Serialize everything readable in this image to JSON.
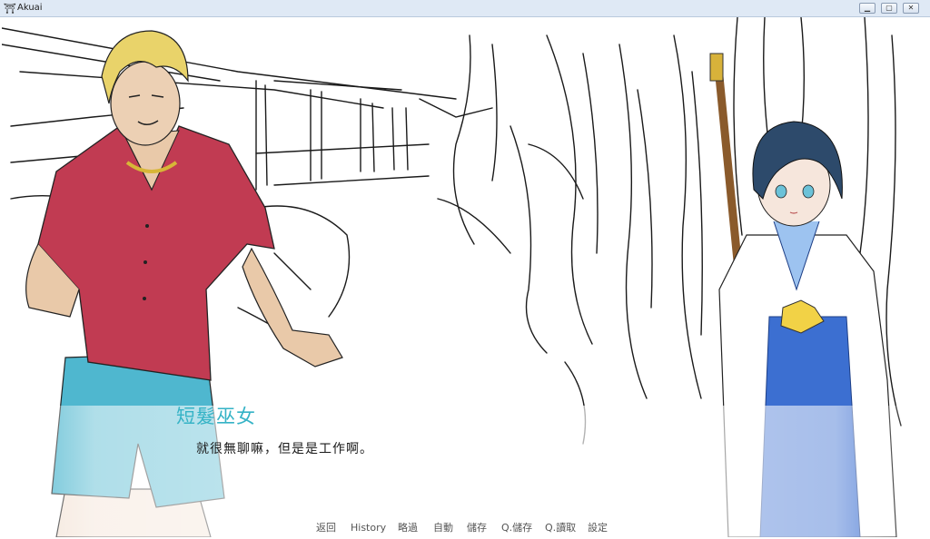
{
  "window": {
    "title": "Akuai",
    "icon": "torii-gate-icon",
    "controls": {
      "minimize": "minimize-icon",
      "maximize": "maximize-icon",
      "close": "close-icon"
    }
  },
  "dialogue": {
    "speaker": "短髮巫女",
    "text": "就很無聊嘛，但是是工作啊。",
    "speaker_color": "#35b3c6"
  },
  "quick_menu": {
    "items": [
      {
        "label": "返回"
      },
      {
        "label": "History"
      },
      {
        "label": "略過"
      },
      {
        "label": "自動"
      },
      {
        "label": "儲存"
      },
      {
        "label": "Q.儲存"
      },
      {
        "label": "Q.讀取"
      },
      {
        "label": "設定"
      }
    ]
  },
  "colors": {
    "shirt": "#c13b52",
    "shorts": "#4fb7cf",
    "hair_blonde": "#e9d36a",
    "miko_hair": "#2d4a6b",
    "hakama": "#3c6fd1"
  }
}
